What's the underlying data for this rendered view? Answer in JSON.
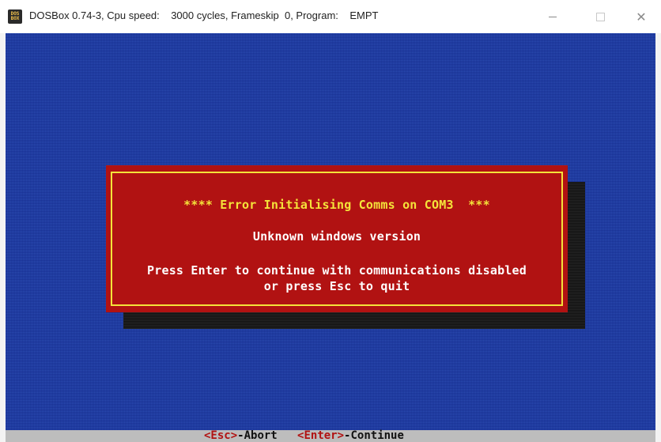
{
  "window": {
    "title": "DOSBox 0.74-3, Cpu speed:    3000 cycles, Frameskip  0, Program:    EMPT",
    "app_icon_top": "DOS",
    "app_icon_bottom": "BOX",
    "controls": {
      "minimize_icon": "minimize-icon",
      "maximize_icon": "maximize-icon",
      "close_glyph": "✕"
    }
  },
  "dialog": {
    "error_line": "**** Error Initialising Comms on COM3  ***",
    "unknown_line": "Unknown windows version",
    "press_line_1": "Press Enter to continue with communications disabled",
    "press_line_2": "or press Esc to quit"
  },
  "statusbar": {
    "esc_key": "<Esc>",
    "esc_action": "-Abort",
    "enter_key": "<Enter>",
    "enter_action": "-Continue"
  },
  "colors": {
    "screen_blue": "#1f3fa0",
    "dialog_red": "#b11212",
    "border_yellow": "#f4e33a",
    "status_gray": "#bdbdbd"
  }
}
